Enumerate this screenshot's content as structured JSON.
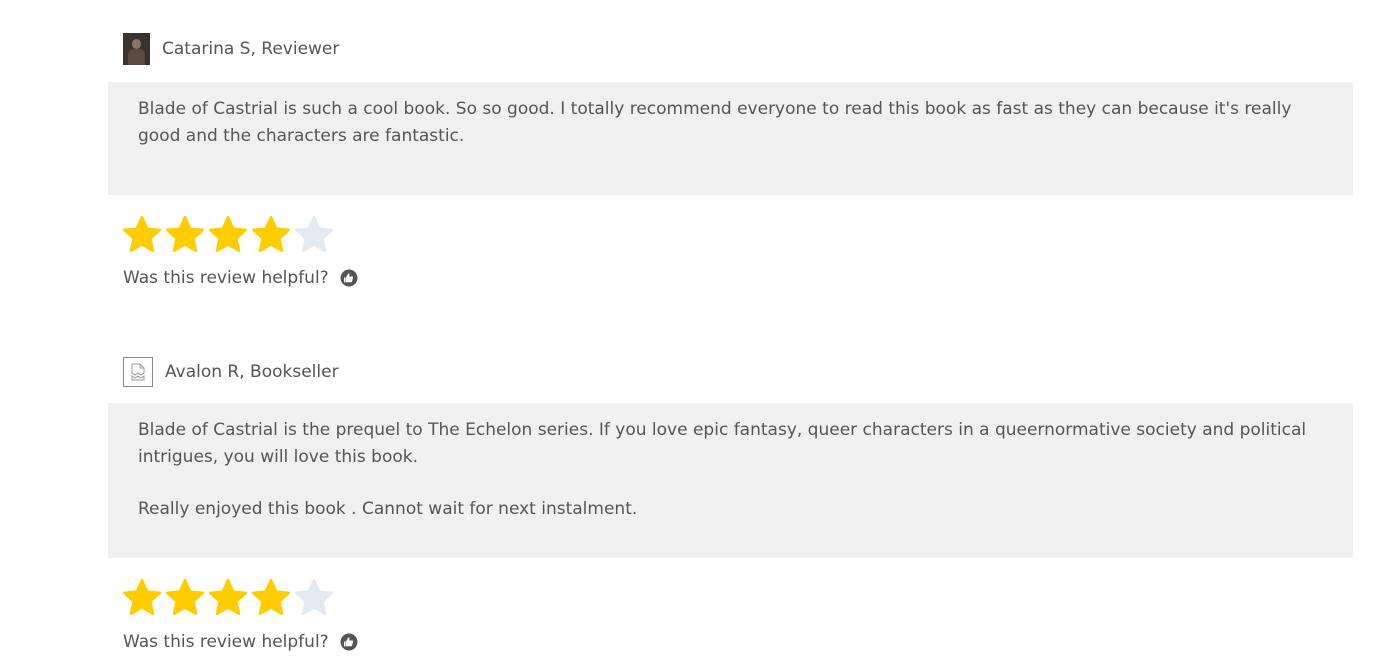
{
  "colors": {
    "star_filled": "#ffcc00",
    "star_empty": "#e3e9f0",
    "review_bg": "#f0f0f0",
    "text": "#555555"
  },
  "reviews": [
    {
      "reviewer": "Catarina S, Reviewer",
      "avatar_icon": "user-photo",
      "paragraphs": [
        "Blade of Castrial is such a cool book. So so good. I totally recommend everyone to read this book as fast as they can because it's really good and the characters are fantastic."
      ],
      "rating": 4,
      "max_rating": 5,
      "helpful_label": "Was this review helpful?",
      "helpful_icon": "thumbs-up-icon"
    },
    {
      "reviewer": "Avalon R, Bookseller",
      "avatar_icon": "broken-image-icon",
      "paragraphs": [
        "Blade of Castrial is the prequel to The Echelon series. If you love epic fantasy, queer characters in a queernormative society and political intrigues, you will love this book.",
        "Really enjoyed this book . Cannot wait for next instalment."
      ],
      "rating": 4,
      "max_rating": 5,
      "helpful_label": "Was this review helpful?",
      "helpful_icon": "thumbs-up-icon"
    }
  ]
}
